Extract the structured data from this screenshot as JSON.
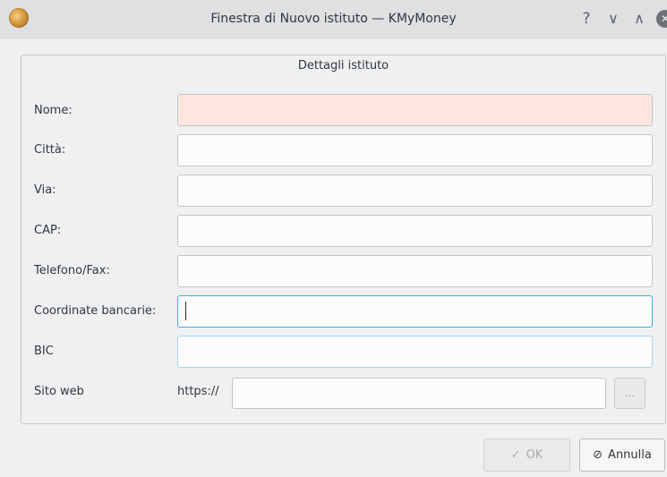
{
  "window": {
    "title": "Finestra di Nuovo istituto — KMyMoney",
    "help_glyph": "?",
    "min_glyph": "∨",
    "max_glyph": "∧",
    "close_glyph": "✕"
  },
  "group": {
    "title": "Dettagli istituto"
  },
  "fields": {
    "name_label": "Nome:",
    "name_value": "",
    "city_label": "Città:",
    "city_value": "",
    "street_label": "Via:",
    "street_value": "",
    "zip_label": "CAP:",
    "zip_value": "",
    "phone_label": "Telefono/Fax:",
    "phone_value": "",
    "bank_code_label": "Coordinate bancarie:",
    "bank_code_value": "",
    "bic_label": "BIC",
    "bic_value": "",
    "website_label": "Sito web",
    "website_prefix": "https://",
    "website_value": "",
    "browse_label": "..."
  },
  "buttons": {
    "ok_icon": "✓",
    "ok_label": "OK",
    "cancel_icon": "⊘",
    "cancel_label": "Annulla"
  },
  "colors": {
    "required_field_bg": "#fce6df",
    "focus_border": "#3daee9"
  }
}
